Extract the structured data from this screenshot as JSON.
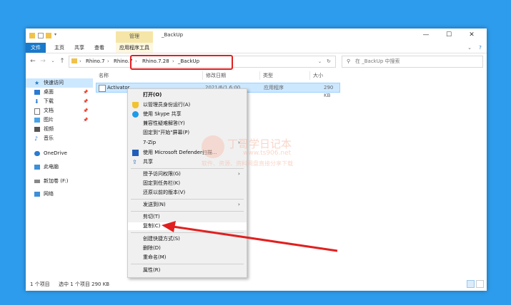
{
  "window": {
    "title": "_BackUp",
    "manage_tab": "管理",
    "controls": {
      "minimize": "—",
      "maximize": "☐",
      "close": "✕",
      "expand": "⌄",
      "help": "?"
    }
  },
  "ribbon": {
    "tabs": [
      "文件",
      "主页",
      "共享",
      "查看",
      "应用程序工具"
    ]
  },
  "address": {
    "crumbs": [
      "Rhino.7",
      "Rhino.7",
      "Rhino.7.28",
      "_BackUp"
    ],
    "search_placeholder": "在 _BackUp 中搜索"
  },
  "nav": {
    "items": [
      {
        "label": "快速访问",
        "icon": "star-icon",
        "pinned": false
      },
      {
        "label": "桌面",
        "icon": "desktop-icon",
        "pinned": true
      },
      {
        "label": "下载",
        "icon": "download-icon",
        "pinned": true
      },
      {
        "label": "文档",
        "icon": "document-icon",
        "pinned": true
      },
      {
        "label": "图片",
        "icon": "picture-icon",
        "pinned": true
      },
      {
        "label": "视频",
        "icon": "video-icon",
        "pinned": false
      },
      {
        "label": "音乐",
        "icon": "music-icon",
        "pinned": false
      },
      {
        "label": "OneDrive",
        "icon": "cloud-icon",
        "pinned": false
      },
      {
        "label": "此电脑",
        "icon": "computer-icon",
        "pinned": false
      },
      {
        "label": "新加卷 (F:)",
        "icon": "drive-icon",
        "pinned": false
      },
      {
        "label": "网络",
        "icon": "network-icon",
        "pinned": false
      }
    ],
    "pin_glyph": "📌"
  },
  "columns": {
    "name": "名称",
    "date": "修改日期",
    "type": "类型",
    "size": "大小"
  },
  "file": {
    "name": "Activator",
    "date": "2021/6/1 6:00",
    "type": "应用程序",
    "size": "290 KB"
  },
  "status": {
    "count": "1 个项目",
    "selected": "选中 1 个项目  290 KB"
  },
  "context_menu": {
    "items": [
      {
        "label": "打开(O)",
        "icon": "",
        "bold": true
      },
      {
        "label": "以管理员身份运行(A)",
        "icon": "shield-icon"
      },
      {
        "label": "使用 Skype 共享",
        "icon": "skype-icon"
      },
      {
        "label": "兼容性疑难解答(Y)",
        "icon": ""
      },
      {
        "label": "固定到\"开始\"屏幕(P)",
        "icon": ""
      },
      {
        "label": "7-Zip",
        "icon": "",
        "arrow": true
      },
      {
        "label": "使用 Microsoft Defender扫描...",
        "icon": "defender-icon"
      },
      {
        "label": "共享",
        "icon": "share-icon"
      },
      {
        "label": "授予访问权限(G)",
        "icon": "",
        "arrow": true
      },
      {
        "label": "固定到任务栏(K)",
        "icon": ""
      },
      {
        "label": "还原以前的版本(V)",
        "icon": ""
      },
      {
        "label": "发送到(N)",
        "icon": "",
        "arrow": true
      },
      {
        "label": "剪切(T)",
        "icon": ""
      },
      {
        "label": "复制(C)",
        "icon": "",
        "hover": true
      },
      {
        "label": "创建快捷方式(S)",
        "icon": ""
      },
      {
        "label": "删除(D)",
        "icon": ""
      },
      {
        "label": "重命名(M)",
        "icon": ""
      },
      {
        "label": "属性(R)",
        "icon": ""
      }
    ],
    "arrow_glyph": "›"
  },
  "watermark": {
    "title": "丁哥学日记本",
    "url": "www.ts906.net",
    "tagline": "软件、资源、资料网盘直接分享下载"
  },
  "colors": {
    "desktop": "#2e9cec",
    "accent": "#1979ca",
    "selection": "#cce8ff",
    "highlight_red": "#e02020"
  }
}
